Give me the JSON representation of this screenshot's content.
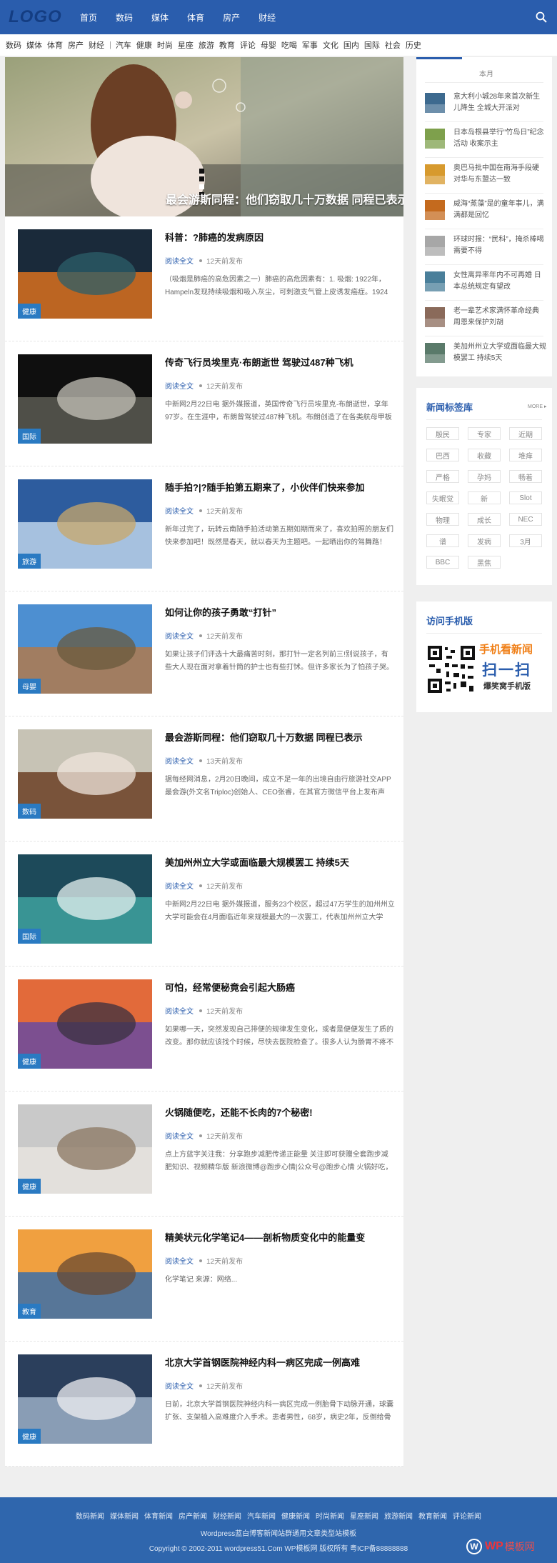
{
  "header": {
    "logo": "LOGO",
    "nav": [
      "首页",
      "数码",
      "媒体",
      "体育",
      "房产",
      "财经"
    ]
  },
  "subnav": {
    "group1": [
      "数码",
      "媒体",
      "体育",
      "房产",
      "财经"
    ],
    "group2": [
      "汽车",
      "健康",
      "时尚",
      "星座",
      "旅游",
      "教育",
      "评论",
      "母婴",
      "吃喝",
      "军事",
      "文化",
      "国内",
      "国际",
      "社会",
      "历史"
    ]
  },
  "slider": {
    "caption": "最会游斯同程：他们窃取几十万数据 同程已表示"
  },
  "articles": [
    {
      "title": "科普：?肺癌的发病原因",
      "read": "阅读全文",
      "time": "12天前发布",
      "category": "健康",
      "excerpt": "（吸烟是肺癌的高危因素之一）肺癌的高危因素有：1. 吸烟: 1922年，Hampeln发现持续吸烟和吸入灰尘，可刺激支气管上皮诱发癌症。1924"
    },
    {
      "title": "传奇飞行员埃里克·布朗逝世 驾驶过487种飞机",
      "read": "阅读全文",
      "time": "12天前发布",
      "category": "国际",
      "excerpt": "中新网2月22日电 据外媒报道，英国传奇飞行员埃里克·布朗逝世，享年97岁。在生涯中，布朗曾驾驶过487种飞机。布朗创造了在各类航母甲板上"
    },
    {
      "title": "随手拍?|?随手拍第五期来了，小伙伴们快来参加",
      "read": "阅读全文",
      "time": "12天前发布",
      "category": "旅游",
      "excerpt": "新年过完了，玩转云南随手拍活动第五期如期而来了，喜欢拍照的朋友们快来参加吧！既然是春天，就以春天为主题吧。一起晒出你的驾舞路！"
    },
    {
      "title": "如何让你的孩子勇敢“打针”",
      "read": "阅读全文",
      "time": "12天前发布",
      "category": "母婴",
      "excerpt": "如果让孩子们评选十大最痛苦时刻，那打针一定名列前三!别说孩子，有些大人现在面对拿着针筒的护士也有些打怵。但许多家长为了怕孩子哭。"
    },
    {
      "title": "最会游斯同程：他们窃取几十万数据 同程已表示",
      "read": "阅读全文",
      "time": "13天前发布",
      "category": "数码",
      "excerpt": "据每经网消息，2月20日晚间，成立不足一年的出境自由行旅游社交APP最会游(外文名Triploc)创始人、CEO张睿，在其官方微信平台上发布声"
    },
    {
      "title": "美加州州立大学或面临最大规模罢工 持续5天",
      "read": "阅读全文",
      "time": "12天前发布",
      "category": "国际",
      "excerpt": "中新网2月22日电 据外媒报道，服务23个校区，超过47万学生的加州州立大学可能会在4月面临近年来规模最大的一次罢工，代表加州州立大学"
    },
    {
      "title": "可怕，经常便秘竟会引起大肠癌",
      "read": "阅读全文",
      "time": "12天前发布",
      "category": "健康",
      "excerpt": "如果哪一天，突然发现自己排便的规律发生变化，或者是便便发生了质的改变。那你就应该找个时候，尽快去医院检查了。很多人认为肠胃不疼不"
    },
    {
      "title": "火锅随便吃，还能不长肉的7个秘密!",
      "read": "阅读全文",
      "time": "12天前发布",
      "category": "健康",
      "excerpt": "点上方蓝字关注我：分享跑步减肥传递正能量 关注即可获赠全套跑步减肥知识、视频精华版 新浪微博@跑步心情|公众号@跑步心情 火锅好吃，"
    },
    {
      "title": "精美状元化学笔记4——剖析物质变化中的能量变",
      "read": "阅读全文",
      "time": "12天前发布",
      "category": "教育",
      "excerpt": "化学笔记 来源：网络..."
    },
    {
      "title": "北京大学首钢医院神经内科一病区完成一例高难",
      "read": "阅读全文",
      "time": "12天前发布",
      "category": "健康",
      "excerpt": "日前，北京大学首钢医院神经内科一病区完成一例胎骨下动脉开通，球囊扩张、支架植入高难度介入手术。患者男性，68岁，病史2年，反倒给骨"
    }
  ],
  "sidebar": {
    "monthly": {
      "tab": "本月",
      "items": [
        "意大利小城28年来首次新生儿降生 全城大开派对",
        "日本岛根县举行“竹岛日”纪念活动 收案示主",
        "奥巴马批中国在南海手段硬 对华与东盟达一致",
        "威海“蒸藻”是的童年事儿，满满都是回忆",
        "环球时报：“民科”，掩杀棒喝需要不得",
        "女性离异率年内不可再婚 日本总统规定有望改",
        "老一辈艺术家满怀革命经典 周恩来保护刘胡",
        "美加州州立大学或面临最大规模罢工 持续5天"
      ]
    },
    "tags": {
      "title": "新闻标签库",
      "more": "MORE ▸",
      "items": [
        "殷民",
        "专家",
        "近期",
        "巴西",
        "收藏",
        "堆痒",
        "严格",
        "孕妈",
        "畅着",
        "失眠觉",
        "新",
        "Slot",
        "物理",
        "成长",
        "NEC",
        "谱",
        "发病",
        "3月",
        "BBC",
        "黑焦"
      ]
    },
    "mobile": {
      "title": "访问手机版",
      "line1": "手机看新闻",
      "line2": "扫一扫",
      "line3": "爆笑窝手机版"
    }
  },
  "footer": {
    "links": [
      "数码新闻",
      "媒体新闻",
      "体育新闻",
      "房产新闻",
      "财经新闻",
      "汽车新闻",
      "健康新闻",
      "时尚新闻",
      "星座新闻",
      "旅游新闻",
      "教育新闻",
      "评论新闻"
    ],
    "line2": "Wordpress蓝白博客新闻站群通用文章类型站模板",
    "line3": "Copyright © 2002-2011 wordpress51.Com WP模板网 版权所有  粤ICP备88888888",
    "brand_wp": "WP",
    "brand_name": "模板网"
  }
}
